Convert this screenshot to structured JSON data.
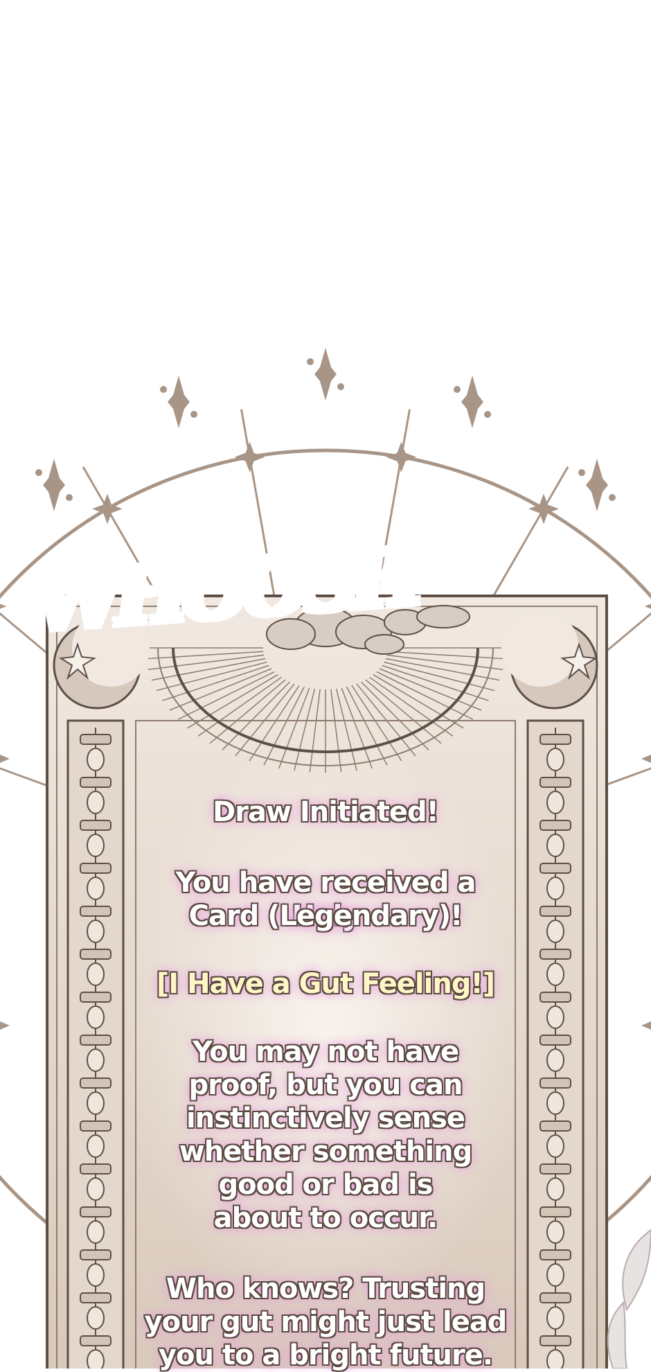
{
  "sfx": {
    "text": "WHOOSH"
  },
  "card": {
    "heading": "Draw Initiated!",
    "received_line1": "You have received a Holy",
    "received_line2": "Card (Legendary)!",
    "card_name": "[I Have a Gut Feeling!]",
    "desc_lines": [
      "You may not have",
      "proof, but you can",
      "instinctively sense",
      "whether something",
      "good or bad is",
      "about to occur."
    ],
    "closing_lines": [
      "Who knows? Trusting",
      "your gut might just lead",
      "you to a bright future."
    ]
  },
  "colors": {
    "frame": "#a89586",
    "frame_dark": "#5e4f46",
    "card_bg": "#e8ddd2",
    "sfx": "#6e1a12"
  }
}
